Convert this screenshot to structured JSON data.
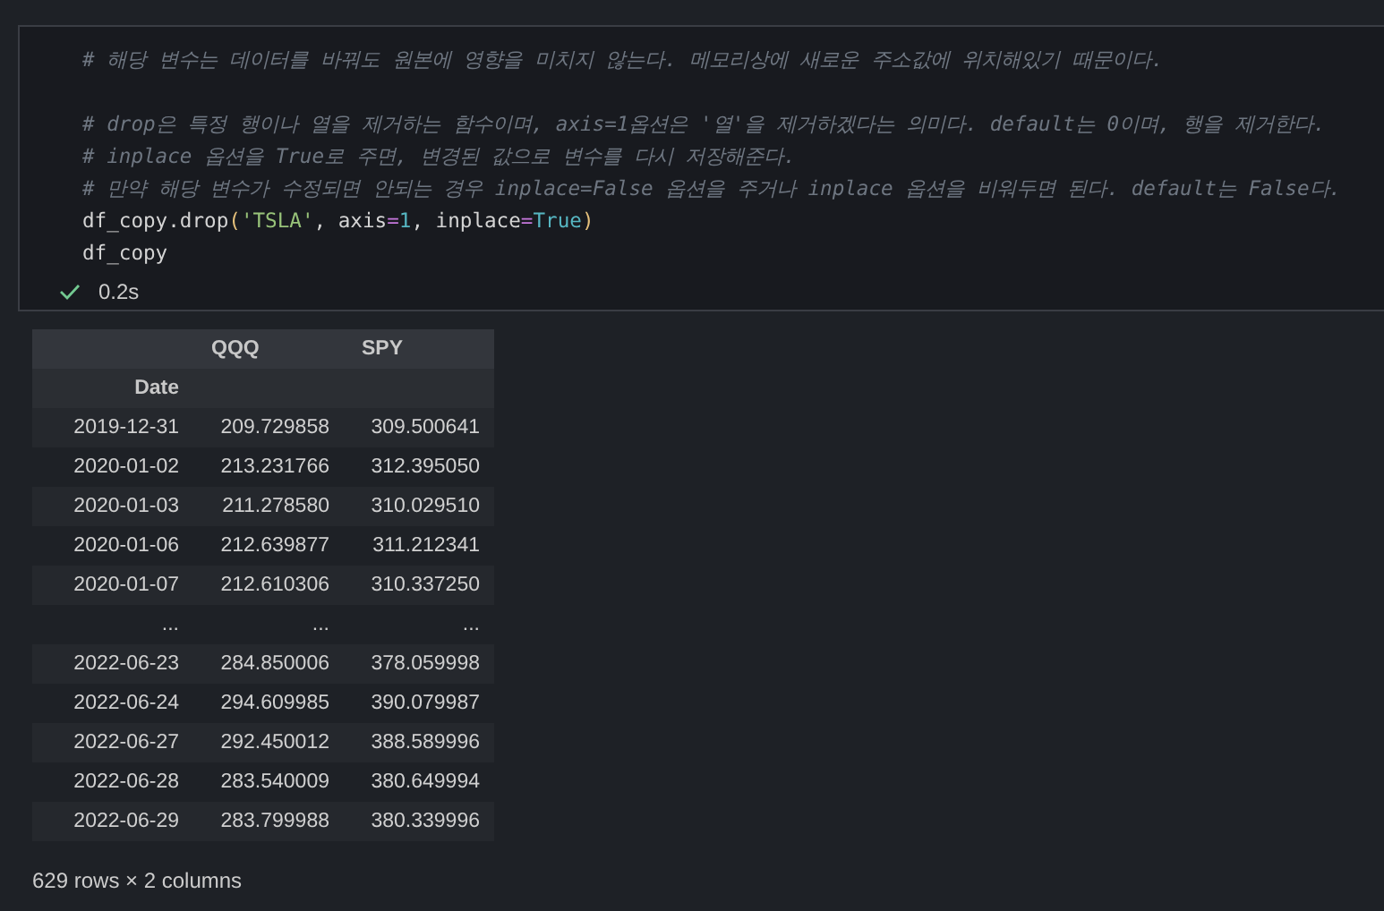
{
  "code_cell": {
    "lines": [
      [
        {
          "kind": "comment",
          "text": "# 해당 변수는 데이터를 바꿔도 원본에 영향을 미치지 않는다. 메모리상에 새로운 주소값에 위치해있기 때문이다."
        }
      ],
      [
        {
          "kind": "comment",
          "text": "# drop은 특정 행이나 열을 제거하는 함수이며, axis=1옵션은 '열'을 제거하겠다는 의미다. default는 0이며, 행을 제거한다."
        }
      ],
      [
        {
          "kind": "comment",
          "text": "# inplace 옵션을 True로 주면, 변경된 값으로 변수를 다시 저장해준다."
        }
      ],
      [
        {
          "kind": "comment",
          "text": "# 만약 해당 변수가 수정되면 안되는 경우 inplace=False 옵션을 주거나 inplace 옵션을 비워두면 된다. default는 False다."
        }
      ],
      [
        {
          "kind": "plain",
          "text": "df_copy.drop"
        },
        {
          "kind": "paren",
          "text": "("
        },
        {
          "kind": "string",
          "text": "'TSLA'"
        },
        {
          "kind": "plain",
          "text": ", axis"
        },
        {
          "kind": "operator",
          "text": "="
        },
        {
          "kind": "number",
          "text": "1"
        },
        {
          "kind": "plain",
          "text": ", inplace"
        },
        {
          "kind": "operator",
          "text": "="
        },
        {
          "kind": "keyword",
          "text": "True"
        },
        {
          "kind": "paren",
          "text": ")"
        }
      ],
      [
        {
          "kind": "plain",
          "text": "df_copy"
        }
      ]
    ],
    "succeeded": true,
    "duration": "0.2s"
  },
  "output_table": {
    "columns": [
      "",
      "QQQ",
      "SPY"
    ],
    "index_name": "Date",
    "rows": [
      [
        "2019-12-31",
        "209.729858",
        "309.500641"
      ],
      [
        "2020-01-02",
        "213.231766",
        "312.395050"
      ],
      [
        "2020-01-03",
        "211.278580",
        "310.029510"
      ],
      [
        "2020-01-06",
        "212.639877",
        "311.212341"
      ],
      [
        "2020-01-07",
        "212.610306",
        "310.337250"
      ],
      [
        "...",
        "...",
        "..."
      ],
      [
        "2022-06-23",
        "284.850006",
        "378.059998"
      ],
      [
        "2022-06-24",
        "294.609985",
        "390.079987"
      ],
      [
        "2022-06-27",
        "292.450012",
        "388.589996"
      ],
      [
        "2022-06-28",
        "283.540009",
        "380.649994"
      ],
      [
        "2022-06-29",
        "283.799988",
        "380.339996"
      ]
    ],
    "summary": "629 rows × 2 columns"
  }
}
